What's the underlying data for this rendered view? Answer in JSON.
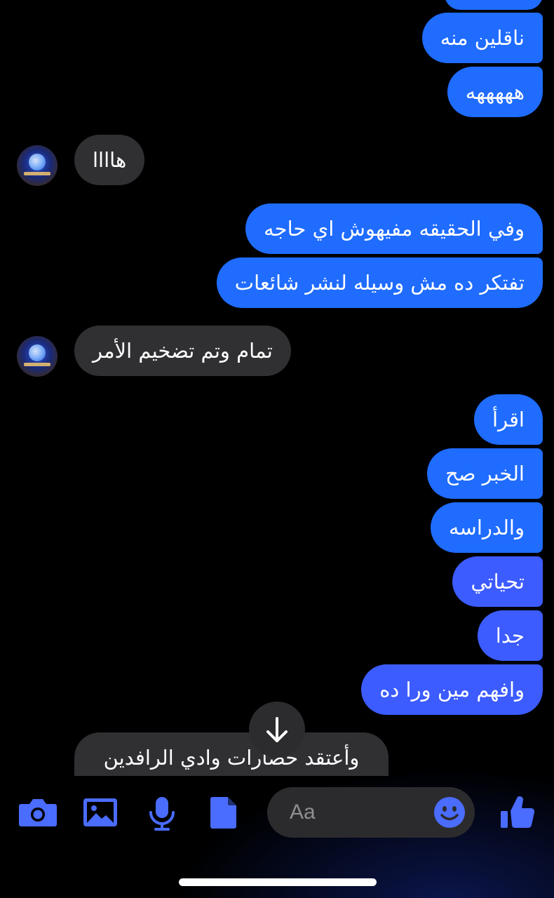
{
  "conversation": {
    "sent_messages": [
      {
        "text": "ناقلين منه"
      },
      {
        "text": "هههههه"
      },
      {
        "text": "وفي الحقيقه مفيهوش اي حاجه"
      },
      {
        "text": "تفتكر ده مش وسيله لنشر شائعات"
      },
      {
        "text": "اقرأ"
      },
      {
        "text": "الخبر صح"
      },
      {
        "text": "والدراسه"
      },
      {
        "text": "تحياتي"
      },
      {
        "text": "جدا"
      },
      {
        "text": "وافهم مين ورا ده"
      }
    ],
    "received_messages": [
      {
        "text": "هاااا"
      },
      {
        "text": "تمام وتم تضخيم الأمر"
      },
      {
        "text": "وأعتقد حضارات وادي الرافدين"
      }
    ]
  },
  "composer": {
    "placeholder": "Aa",
    "icons": [
      "camera-icon",
      "photo-icon",
      "microphone-icon",
      "file-icon",
      "emoji-icon",
      "thumbs-up-icon"
    ]
  },
  "colors": {
    "sent_bubble": "#1f6cff",
    "sent_bubble_violet": "#3c5cff",
    "received_bubble": "#303033",
    "accent_icon": "#4a6cff",
    "background": "#000000"
  }
}
